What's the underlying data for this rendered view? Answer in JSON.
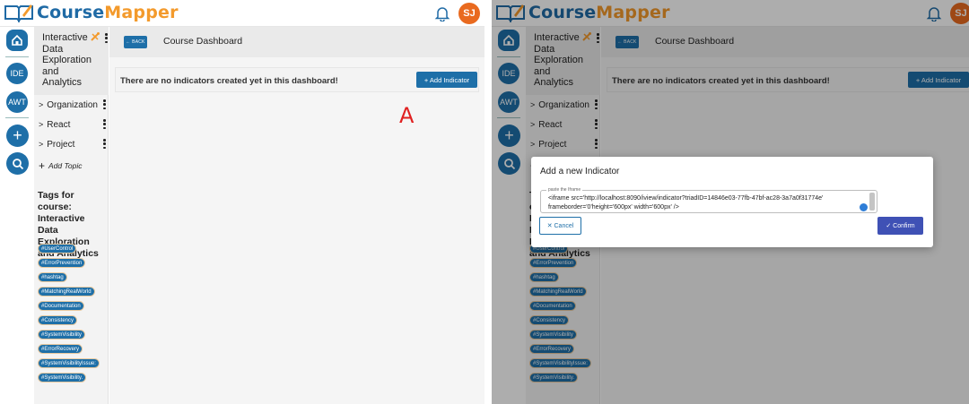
{
  "app": {
    "logo_text_blue": "Course",
    "logo_text_orange": "Mapper",
    "user_initials": "SJ"
  },
  "rail": {
    "items": [
      {
        "label": "IDE"
      },
      {
        "label": "AWT"
      }
    ],
    "add_glyph": "+"
  },
  "course": {
    "title": "Interactive Data Exploration and Analytics"
  },
  "topics": [
    {
      "label": "Organization"
    },
    {
      "label": "React"
    },
    {
      "label": "Project"
    }
  ],
  "add_topic": {
    "label": "Add Topic"
  },
  "tags": {
    "title": "Tags for course: Interactive Data Exploration and Analytics",
    "items": [
      "#UserControl",
      "#ErrorPrevention",
      "#hashtag",
      "#MatchingRealWorld",
      "#Documentation",
      "#Consistency",
      "#SystemVisibility",
      "#ErrorRecovery",
      "#SystemVisibilityIssue:",
      "#SystemVisibility."
    ]
  },
  "main": {
    "back_label": "← BACK",
    "title": "Course Dashboard",
    "empty_message": "There are no indicators created yet in this dashboard!",
    "add_indicator_label": "+ Add Indicator"
  },
  "annotation": {
    "label": "A"
  },
  "dialog": {
    "title": "Add a new Indicator",
    "field_label": "paste the Iframe",
    "field_value": "<iframe src='http://localhost:8090/iview/indicator?triadID=14846e03-77fb-47bf-ac28-3a7a0f31774e' frameborder='0'height='600px' width='600px' />",
    "cancel_label": "✕ Cancel",
    "confirm_label": "✓ Confirm"
  },
  "colors": {
    "primary": "#1e6fa8",
    "accent": "#f39a2c",
    "avatar": "#e96a1f",
    "confirm": "#3f51b5",
    "annotation": "#e02020"
  }
}
